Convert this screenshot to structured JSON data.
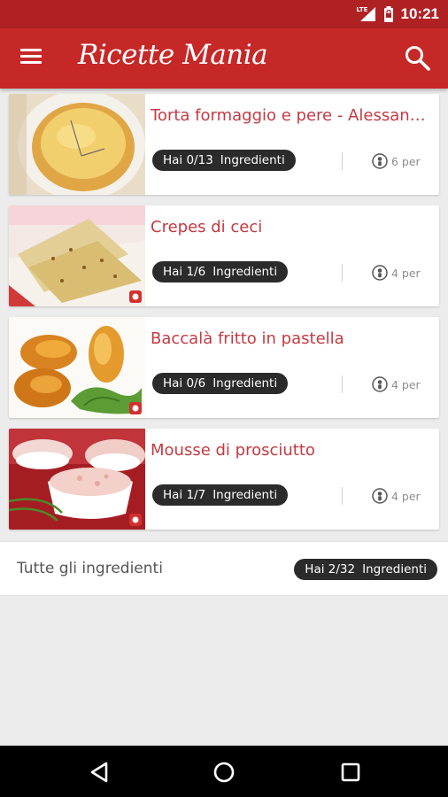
{
  "status_bar": {
    "network": "LTE",
    "time": "10:21"
  },
  "app_bar": {
    "title": "Ricette Mania",
    "menu_icon": "menu-icon",
    "search_icon": "search-icon"
  },
  "recipes": [
    {
      "title": "Torta formaggio e pere - Alessandra",
      "have": "Hai 0/13",
      "ingredients_label": "Ingredienti",
      "servings": "6 per",
      "image": "cheese-pear-cake"
    },
    {
      "title": "Crepes di ceci",
      "have": "Hai 1/6",
      "ingredients_label": "Ingredienti",
      "servings": "4 per",
      "image": "chickpea-crepes"
    },
    {
      "title": "Baccalà fritto in pastella",
      "have": "Hai 0/6",
      "ingredients_label": "Ingredienti",
      "servings": "4 per",
      "image": "fried-cod"
    },
    {
      "title": "Mousse di prosciutto",
      "have": "Hai 1/7",
      "ingredients_label": "Ingredienti",
      "servings": "4 per",
      "image": "ham-mousse"
    }
  ],
  "summary": {
    "label": "Tutte gli ingredienti",
    "have": "Hai 2/32",
    "ingredients_label": "Ingredienti"
  },
  "nav_bar": {
    "back": "back-icon",
    "home": "home-icon",
    "recents": "recents-icon"
  },
  "colors": {
    "primary": "#c62828",
    "status": "#b02124",
    "title_text": "#c43a42",
    "pill": "#2b2b2b"
  }
}
